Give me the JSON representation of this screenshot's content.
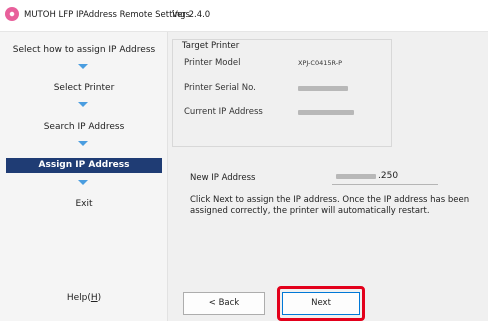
{
  "window": {
    "title": "MUTOH LFP IPAddress Remote Settings",
    "version": "Ver 2.4.0",
    "icon": "mutoh-app-icon"
  },
  "sidebar": {
    "steps": [
      {
        "label": "Select how to assign IP Address"
      },
      {
        "label": "Select Printer"
      },
      {
        "label": "Search IP Address"
      },
      {
        "label": "Assign IP Address",
        "active": true
      },
      {
        "label": "Exit"
      }
    ],
    "help_label": "Help(",
    "help_key": "H",
    "help_close": ")",
    "arrow_color": "#4a9de0",
    "active_color": "#1f3c74"
  },
  "target_printer": {
    "title": "Target Printer",
    "model_label": "Printer Model",
    "model_value": "XPJ-C0415R-P",
    "serial_label": "Printer Serial No.",
    "ip_label": "Current IP Address"
  },
  "assign": {
    "new_ip_label": "New IP Address",
    "new_ip_suffix": ".250",
    "description": "Click Next to assign the IP address. Once the IP address has been assigned correctly, the printer will automatically restart."
  },
  "buttons": {
    "back": "< Back",
    "next": "Next"
  },
  "colors": {
    "highlight": "#e3001b",
    "focus_border": "#0078d7"
  }
}
